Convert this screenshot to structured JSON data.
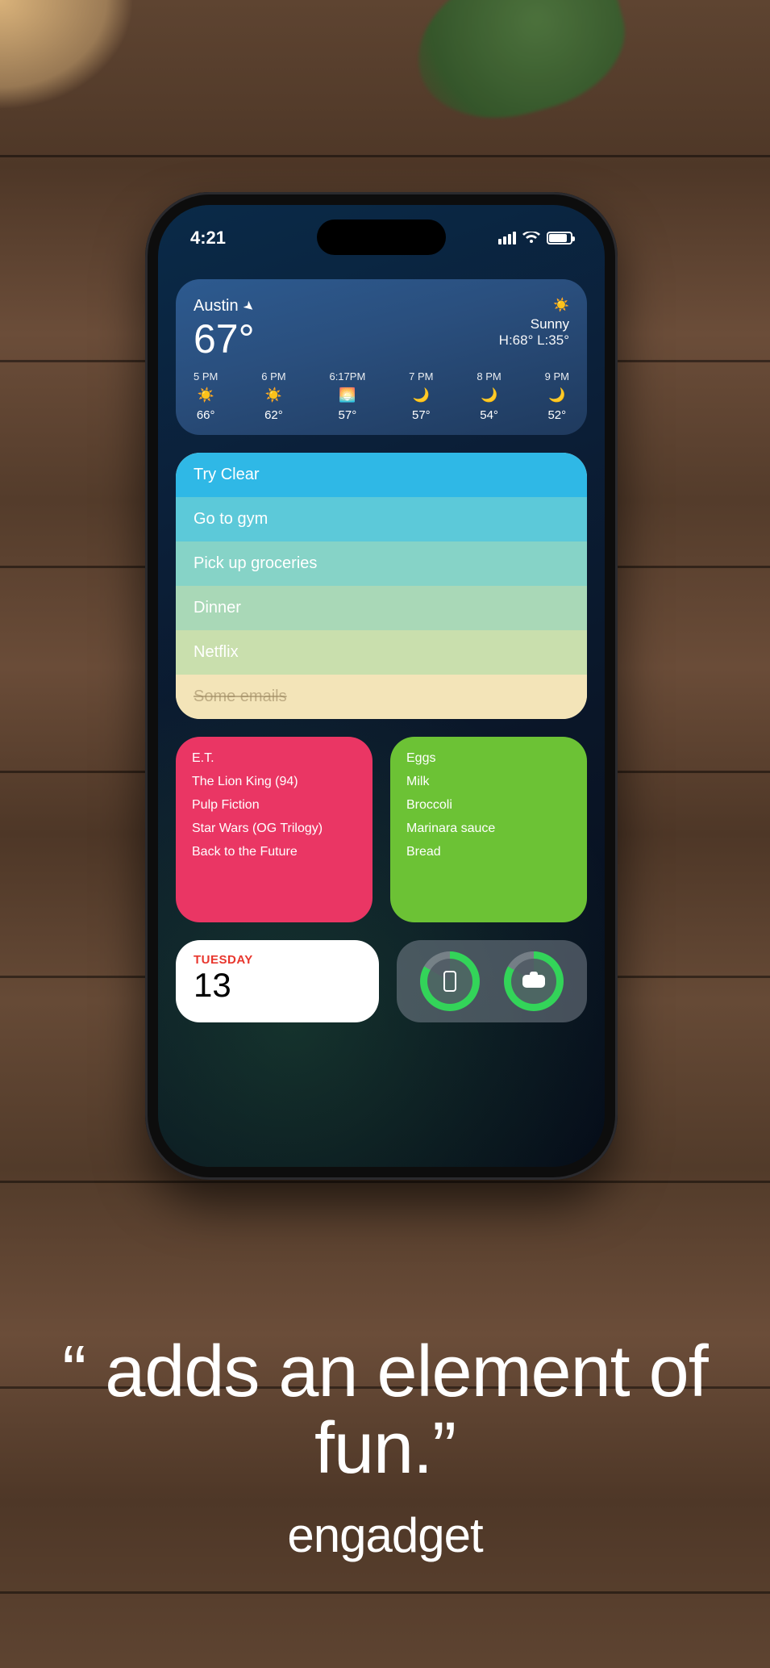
{
  "status": {
    "time": "4:21"
  },
  "weather": {
    "location": "Austin",
    "temp": "67°",
    "condition": "Sunny",
    "hilo": "H:68° L:35°",
    "hourly": [
      {
        "time": "5 PM",
        "icon": "sun",
        "deg": "66°"
      },
      {
        "time": "6 PM",
        "icon": "sun",
        "deg": "62°"
      },
      {
        "time": "6:17PM",
        "icon": "sunset",
        "deg": "57°"
      },
      {
        "time": "7 PM",
        "icon": "moon",
        "deg": "57°"
      },
      {
        "time": "8 PM",
        "icon": "moon",
        "deg": "54°"
      },
      {
        "time": "9 PM",
        "icon": "moon",
        "deg": "52°"
      }
    ]
  },
  "clear_list": {
    "items": [
      {
        "text": "Try Clear",
        "color": "#2fb8e6",
        "done": false
      },
      {
        "text": "Go to gym",
        "color": "#5cc9d9",
        "done": false
      },
      {
        "text": "Pick up groceries",
        "color": "#86d3c7",
        "done": false
      },
      {
        "text": "Dinner",
        "color": "#a9d8b7",
        "done": false
      },
      {
        "text": "Netflix",
        "color": "#c9dfad",
        "done": false
      },
      {
        "text": "Some emails",
        "color": "#f3e4b8",
        "done": true
      }
    ]
  },
  "movies": [
    "E.T.",
    "The Lion King (94)",
    "Pulp Fiction",
    "Star Wars (OG Trilogy)",
    "Back to the Future"
  ],
  "groceries": [
    "Eggs",
    "Milk",
    "Broccoli",
    "Marinara sauce",
    "Bread"
  ],
  "calendar": {
    "dow": "TUESDAY",
    "day": "13"
  },
  "caption": {
    "quote": "“ adds an element of fun.”",
    "brand": "engadget"
  }
}
